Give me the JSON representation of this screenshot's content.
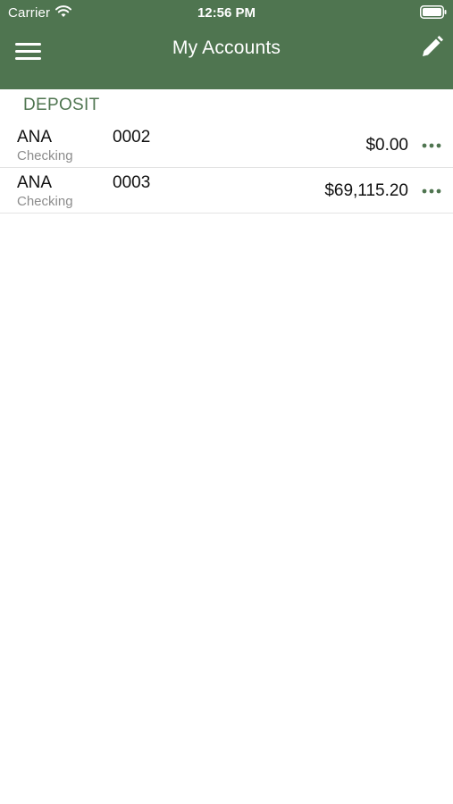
{
  "status_bar": {
    "carrier": "Carrier",
    "time": "12:56 PM",
    "wifi_icon": "wifi-icon",
    "battery_icon": "battery-icon"
  },
  "nav": {
    "title": "My Accounts",
    "menu_icon": "hamburger-menu-icon",
    "edit_icon": "pencil-edit-icon"
  },
  "colors": {
    "header_bg": "#4f7550",
    "accent": "#4f7550",
    "text": "#111111",
    "subtext": "#8c8c8c"
  },
  "section": {
    "title": "DEPOSIT"
  },
  "accounts": [
    {
      "name": "ANA",
      "type": "Checking",
      "number": "0002",
      "balance": "$0.00",
      "more_icon": "more-dots-icon"
    },
    {
      "name": "ANA",
      "type": "Checking",
      "number": "0003",
      "balance": "$69,115.20",
      "more_icon": "more-dots-icon"
    }
  ]
}
